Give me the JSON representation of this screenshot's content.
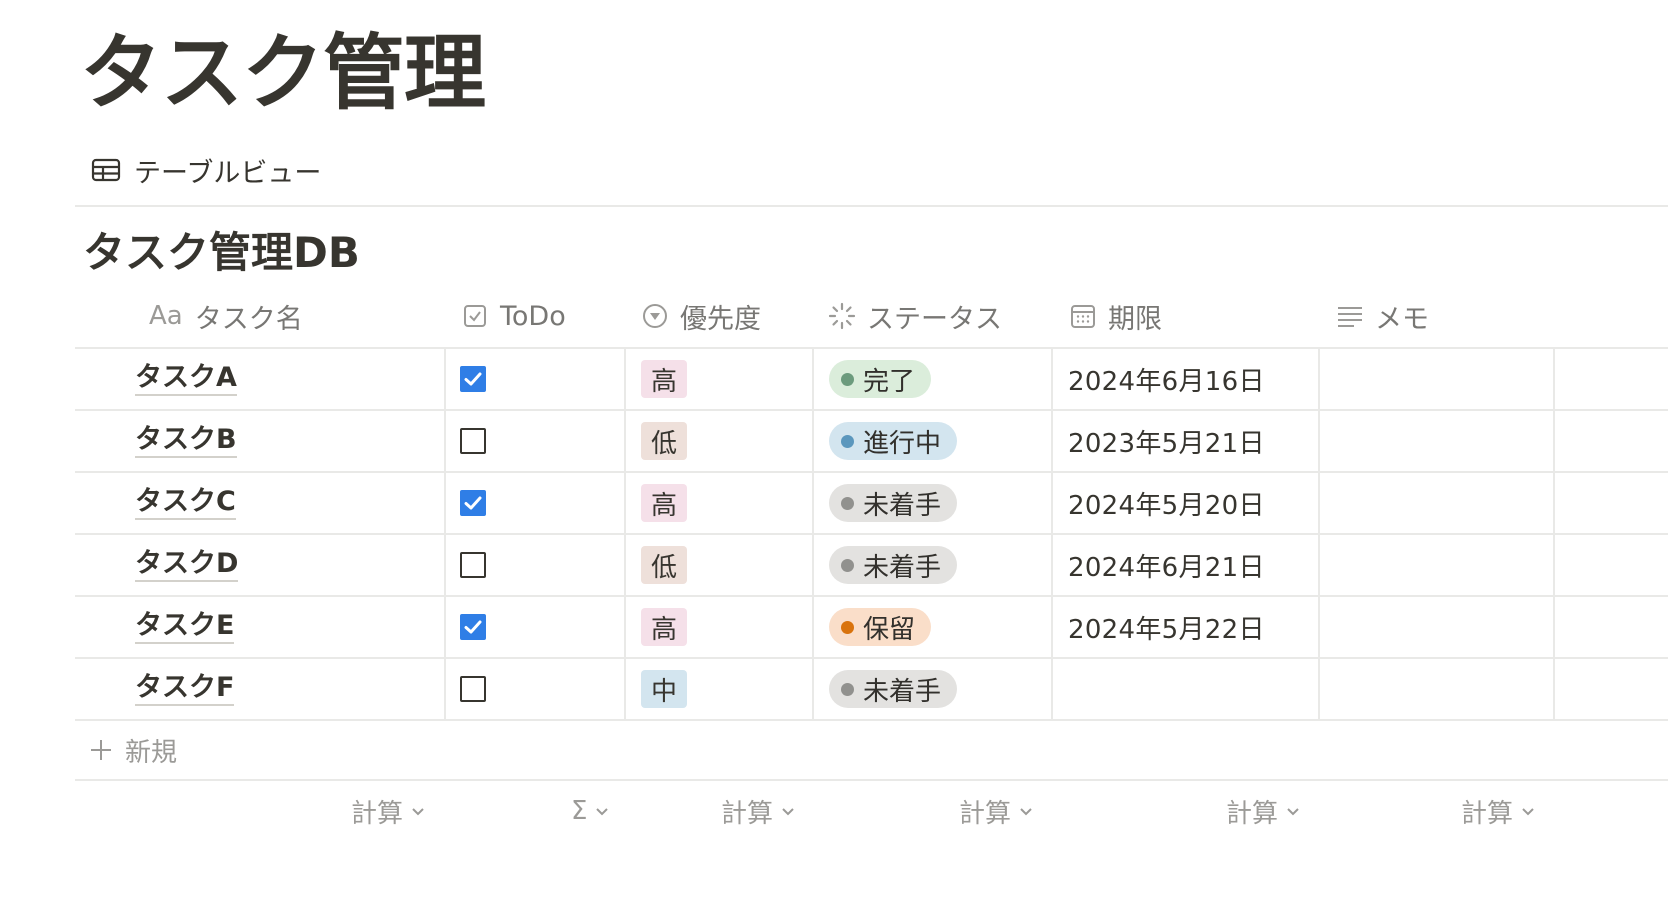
{
  "page": {
    "title": "タスク管理"
  },
  "view": {
    "label": "テーブルビュー",
    "icon": "table-icon"
  },
  "database": {
    "title": "タスク管理DB",
    "columns": [
      {
        "label": "タスク名",
        "prefix": "Aa"
      },
      {
        "label": "ToDo",
        "icon": "checkbox-icon"
      },
      {
        "label": "優先度",
        "icon": "select-icon"
      },
      {
        "label": "ステータス",
        "icon": "status-icon"
      },
      {
        "label": "期限",
        "icon": "calendar-icon"
      },
      {
        "label": "メモ",
        "icon": "text-lines-icon"
      }
    ],
    "rows": [
      {
        "name": "タスクA",
        "todo": true,
        "priority": "高",
        "status": "完了",
        "due": "2024年6月16日"
      },
      {
        "name": "タスクB",
        "todo": false,
        "priority": "低",
        "status": "進行中",
        "due": "2023年5月21日"
      },
      {
        "name": "タスクC",
        "todo": true,
        "priority": "高",
        "status": "未着手",
        "due": "2024年5月20日"
      },
      {
        "name": "タスクD",
        "todo": false,
        "priority": "低",
        "status": "未着手",
        "due": "2024年6月21日"
      },
      {
        "name": "タスクE",
        "todo": true,
        "priority": "高",
        "status": "保留",
        "due": "2024年5月22日"
      },
      {
        "name": "タスクF",
        "todo": false,
        "priority": "中",
        "status": "未着手",
        "due": ""
      }
    ],
    "new_label": "新規",
    "calc_labels": [
      "計算",
      "Σ",
      "計算",
      "計算",
      "計算",
      "計算"
    ]
  },
  "colors": {
    "priority": {
      "高": "#f5e0e9",
      "低": "#eee0da",
      "中": "#d3e5ef"
    },
    "status": {
      "完了": {
        "bg": "#dbeddb",
        "dot": "#6c9b7d"
      },
      "進行中": {
        "bg": "#d3e5ef",
        "dot": "#5b97bd"
      },
      "未着手": {
        "bg": "#e3e2e0",
        "dot": "#91918e"
      },
      "保留": {
        "bg": "#fadec9",
        "dot": "#d9730d"
      }
    },
    "checkbox_checked": "#2f7ee6"
  }
}
